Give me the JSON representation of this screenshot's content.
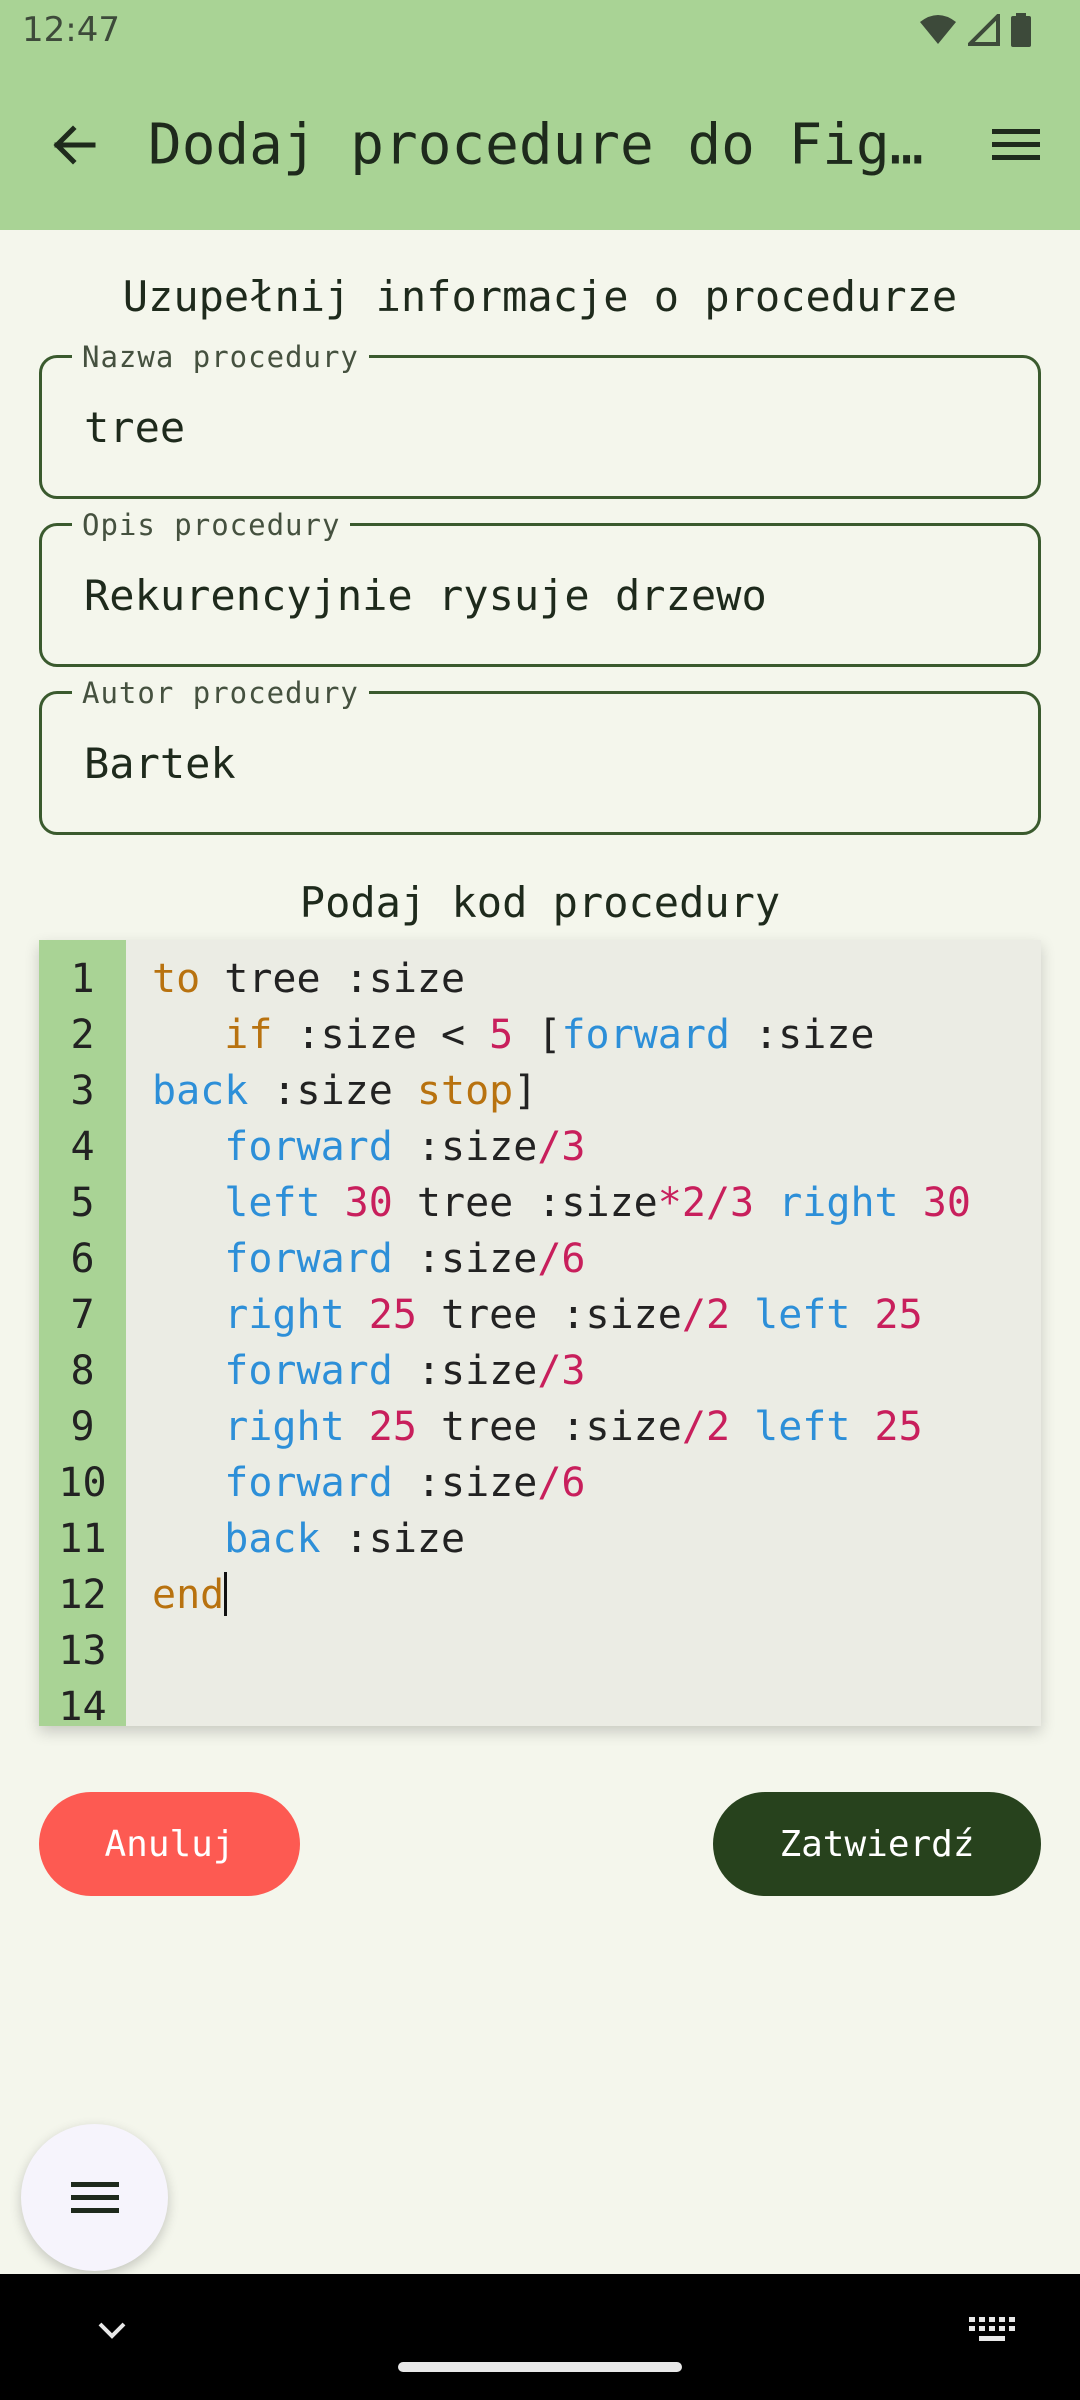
{
  "status_bar": {
    "time": "12:47",
    "icons": [
      "wifi-icon",
      "signal-icon",
      "battery-icon"
    ]
  },
  "app_bar": {
    "title": "Dodaj procedure do Fig…",
    "back_icon": "arrow-back-icon",
    "menu_icon": "hamburger-menu-icon"
  },
  "form": {
    "heading": "Uzupełnij informacje o procedurze",
    "fields": [
      {
        "label": "Nazwa procedury",
        "value": "tree"
      },
      {
        "label": "Opis procedury",
        "value": "Rekurencyjnie rysuje drzewo"
      },
      {
        "label": "Autor procedury",
        "value": "Bartek"
      }
    ]
  },
  "editor": {
    "heading": "Podaj kod procedury",
    "line_numbers": [
      "1",
      "2",
      "3",
      "4",
      "5",
      "6",
      "7",
      "8",
      "9",
      "10",
      "11",
      "12",
      "13",
      "14"
    ],
    "lines": [
      "to tree :size",
      "   if :size < 5 [forward :size",
      "back :size stop]",
      "   forward :size/3",
      "   left 30 tree :size*2/3 right 30",
      "   forward :size/6",
      "   right 25 tree :size/2 left 25",
      "   forward :size/3",
      "   right 25 tree :size/2 left 25",
      "   forward :size/6",
      "   back :size",
      "end",
      "",
      ""
    ]
  },
  "buttons": {
    "cancel": "Anuluj",
    "confirm": "Zatwierdź"
  },
  "colors": {
    "app_bar": "#a9d395",
    "background": "#f4f6ec",
    "cancel_button": "#fd5a52",
    "confirm_button": "#27421d",
    "keyword_control": "#b8720f",
    "keyword_command": "#2d8fd8",
    "number": "#c81f5c"
  },
  "fab": {
    "icon": "hamburger-menu-icon"
  },
  "nav_bar": {
    "left_icon": "chevron-down-icon",
    "right_icon": "keyboard-icon"
  }
}
